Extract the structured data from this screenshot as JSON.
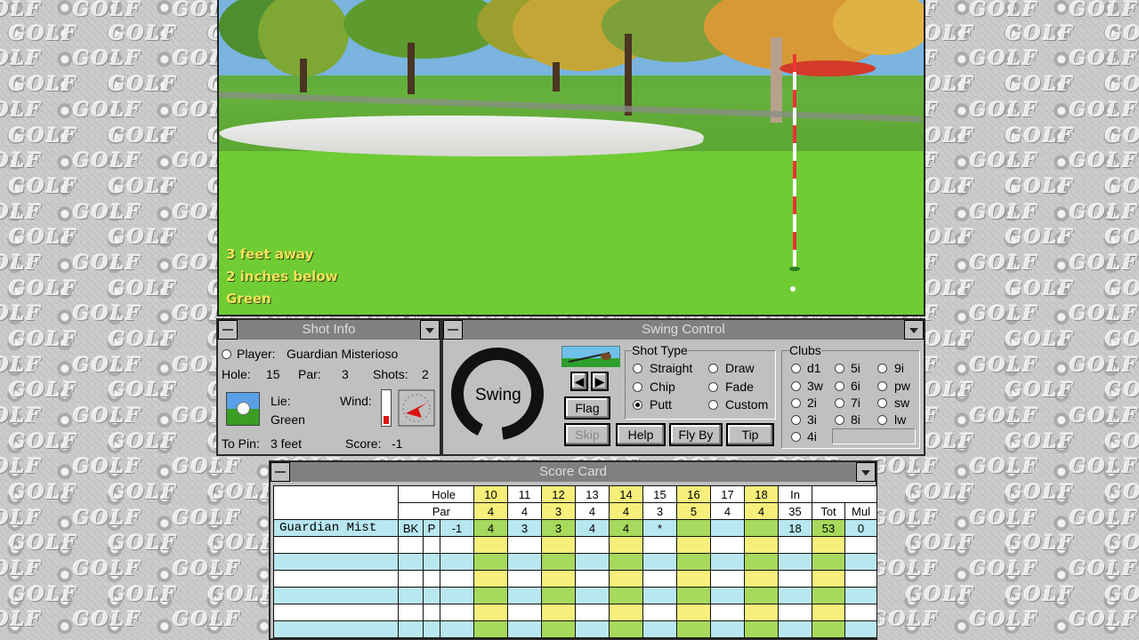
{
  "course_view": {
    "distance": "3 feet away",
    "elevation": "2 inches below",
    "surface": "Green"
  },
  "shot_info": {
    "title": "Shot Info",
    "player_label": "Player:",
    "player_name": "Guardian Misterioso",
    "hole_label": "Hole:",
    "hole_value": "15",
    "par_label": "Par:",
    "par_value": "3",
    "shots_label": "Shots:",
    "shots_value": "2",
    "lie_label": "Lie:",
    "lie_value": "Green",
    "wind_label": "Wind:",
    "topin_label": "To Pin:",
    "topin_value": "3 feet",
    "score_label": "Score:",
    "score_value": "-1"
  },
  "swing_control": {
    "title": "Swing Control",
    "swing_label": "Swing",
    "shot_type_label": "Shot Type",
    "shot_types": [
      "Straight",
      "Draw",
      "Chip",
      "Fade",
      "Putt",
      "Custom"
    ],
    "selected_shot_type": "Putt",
    "clubs_label": "Clubs",
    "clubs": [
      "d1",
      "5i",
      "9i",
      "3w",
      "6i",
      "pw",
      "2i",
      "7i",
      "sw",
      "3i",
      "8i",
      "lw",
      "4i"
    ],
    "buttons": {
      "flag": "Flag",
      "skip": "Skip",
      "help": "Help",
      "flyby": "Fly By",
      "tip": "Tip"
    }
  },
  "score_card": {
    "title": "Score Card",
    "hole_label": "Hole",
    "par_label": "Par",
    "holes": [
      "10",
      "11",
      "12",
      "13",
      "14",
      "15",
      "16",
      "17",
      "18"
    ],
    "pars": [
      "4",
      "4",
      "3",
      "4",
      "4",
      "3",
      "5",
      "4",
      "4"
    ],
    "in_label": "In",
    "in_par": "35",
    "tot_label": "Tot",
    "mul_label": "Mul",
    "player_row": {
      "name": "Guardian Mist",
      "bk": "BK",
      "p": "P",
      "score": "-1",
      "holes": [
        "4",
        "3",
        "3",
        "4",
        "4",
        "*",
        "",
        "",
        ""
      ],
      "in": "18",
      "tot": "53",
      "mul": "0"
    }
  },
  "colors": {
    "wallpaper": "#c8c8c8",
    "panel": "#c0c0c0",
    "titlebar": "#808080",
    "score_yellow": "#f6ef7b",
    "score_green": "#a7d95c",
    "score_blue": "#b9e7f0"
  }
}
